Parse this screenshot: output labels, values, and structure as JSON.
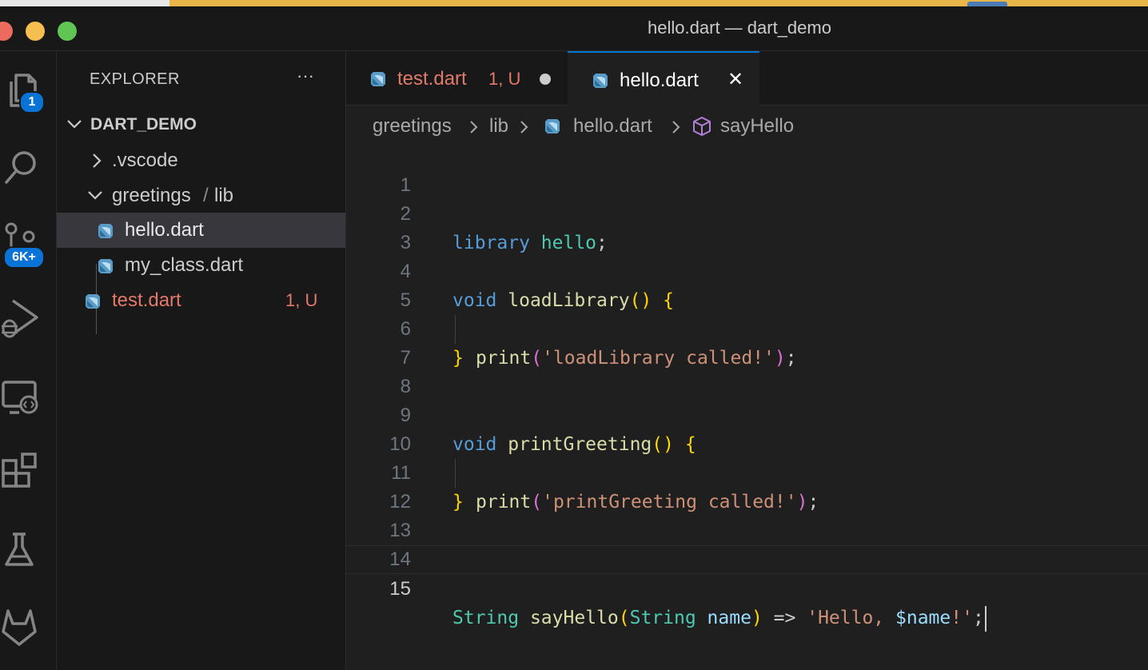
{
  "window": {
    "title": "hello.dart — dart_demo"
  },
  "activity_bar": {
    "explorer_badge": "1",
    "scm_badge": "6K+"
  },
  "explorer": {
    "title": "EXPLORER",
    "more": "···",
    "root": "DART_DEMO",
    "items": [
      {
        "label": ".vscode"
      },
      {
        "label": "greetings",
        "sep": "/",
        "label2": "lib"
      },
      {
        "label": "hello.dart"
      },
      {
        "label": "my_class.dart"
      },
      {
        "label": "test.dart",
        "status": "1, U"
      }
    ]
  },
  "tabs": [
    {
      "label": "test.dart",
      "status": "1, U"
    },
    {
      "label": "hello.dart",
      "close": "✕"
    }
  ],
  "breadcrumbs": [
    "greetings",
    "lib",
    "hello.dart",
    "sayHello"
  ],
  "breadcrumb_sep": ">",
  "code": {
    "line_numbers": [
      "1",
      "2",
      "3",
      "4",
      "5",
      "6",
      "7",
      "8",
      "9",
      "10",
      "11",
      "12",
      "13",
      "14",
      "15"
    ],
    "l2": {
      "kw": "library",
      "name": "hello",
      "semi": ";"
    },
    "l4": {
      "kw": "void",
      "fn": "loadLibrary",
      "paren": "()",
      "brace": "{"
    },
    "l5": {
      "fn": "print",
      "open": "(",
      "str": "'loadLibrary called!'",
      "close": ")",
      "semi": ";"
    },
    "l6": {
      "brace": "}"
    },
    "l9": {
      "kw": "void",
      "fn": "printGreeting",
      "paren": "()",
      "brace": "{"
    },
    "l10": {
      "fn": "print",
      "open": "(",
      "str": "'printGreeting called!'",
      "close": ")",
      "semi": ";"
    },
    "l11": {
      "brace": "}"
    },
    "l15": {
      "type": "String",
      "fn": "sayHello",
      "open": "(",
      "ptype": "String",
      "pname": "name",
      "close": ")",
      "arrow": "=>",
      "str1": "'Hello, ",
      "interp": "$name",
      "str2": "!'",
      "semi": ";"
    }
  },
  "colors": {
    "keyword": "#569cd6",
    "type": "#4ec9b0",
    "function": "#dcdcaa",
    "string": "#ce9178",
    "variable": "#9cdcfe",
    "bracket": "#ffd700",
    "bracket2": "#da70d6",
    "untracked": "#e2796a",
    "dart_icon": "#5a9bc7",
    "accent": "#0078d4"
  }
}
